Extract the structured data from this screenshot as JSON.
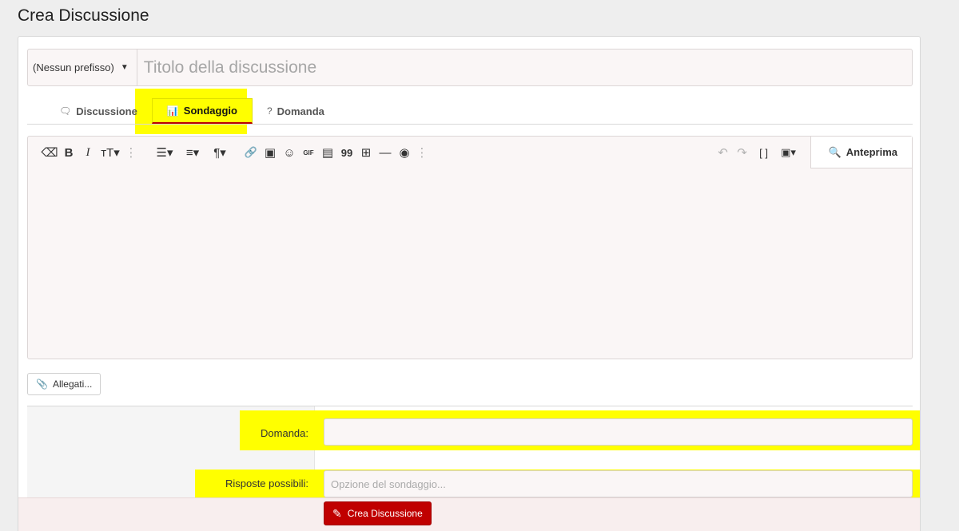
{
  "page": {
    "title": "Crea Discussione"
  },
  "title_row": {
    "prefix_label": "(Nessun prefisso)",
    "title_placeholder": "Titolo della discussione"
  },
  "tabs": [
    {
      "label": "Discussione",
      "icon": "chat-bubbles-icon",
      "active": false
    },
    {
      "label": "Sondaggio",
      "icon": "bar-chart-icon",
      "active": true
    },
    {
      "label": "Domanda",
      "icon": "question-circle-icon",
      "active": false
    }
  ],
  "editor": {
    "toolbar_left": [
      {
        "name": "clear-format-icon",
        "glyph": "⌫"
      },
      {
        "name": "bold-icon",
        "glyph": "B"
      },
      {
        "name": "italic-icon",
        "glyph": "I"
      },
      {
        "name": "font-size-icon",
        "glyph": "тT▾"
      },
      {
        "name": "more-text-icon",
        "glyph": "⋮"
      },
      {
        "name": "list-icon",
        "glyph": "☰▾"
      },
      {
        "name": "align-icon",
        "glyph": "≡▾"
      },
      {
        "name": "paragraph-icon",
        "glyph": "¶▾"
      },
      {
        "name": "link-icon",
        "glyph": "🔗"
      },
      {
        "name": "image-icon",
        "glyph": "▣"
      },
      {
        "name": "emoji-icon",
        "glyph": "☺"
      },
      {
        "name": "gif-icon",
        "glyph": "GIF"
      },
      {
        "name": "media-icon",
        "glyph": "▤"
      },
      {
        "name": "quote-icon",
        "glyph": "99"
      },
      {
        "name": "table-icon",
        "glyph": "⊞"
      },
      {
        "name": "horizontal-rule-icon",
        "glyph": "—"
      },
      {
        "name": "camera-icon",
        "glyph": "◉"
      },
      {
        "name": "more-insert-icon",
        "glyph": "⋮"
      }
    ],
    "toolbar_right": [
      {
        "name": "undo-icon",
        "glyph": "↶"
      },
      {
        "name": "redo-icon",
        "glyph": "↷"
      },
      {
        "name": "brackets-icon",
        "glyph": "[ ]"
      },
      {
        "name": "drafts-icon",
        "glyph": "▣▾"
      }
    ],
    "preview_label": "Anteprima"
  },
  "attachments": {
    "label": "Allegati..."
  },
  "poll": {
    "question_label": "Domanda:",
    "question_value": "",
    "responses_label": "Risposte possibili:",
    "responses_placeholder": "Opzione del sondaggio..."
  },
  "submit": {
    "label": "Crea Discussione"
  },
  "colors": {
    "highlight": "#ffff00",
    "brand": "#c00000"
  }
}
